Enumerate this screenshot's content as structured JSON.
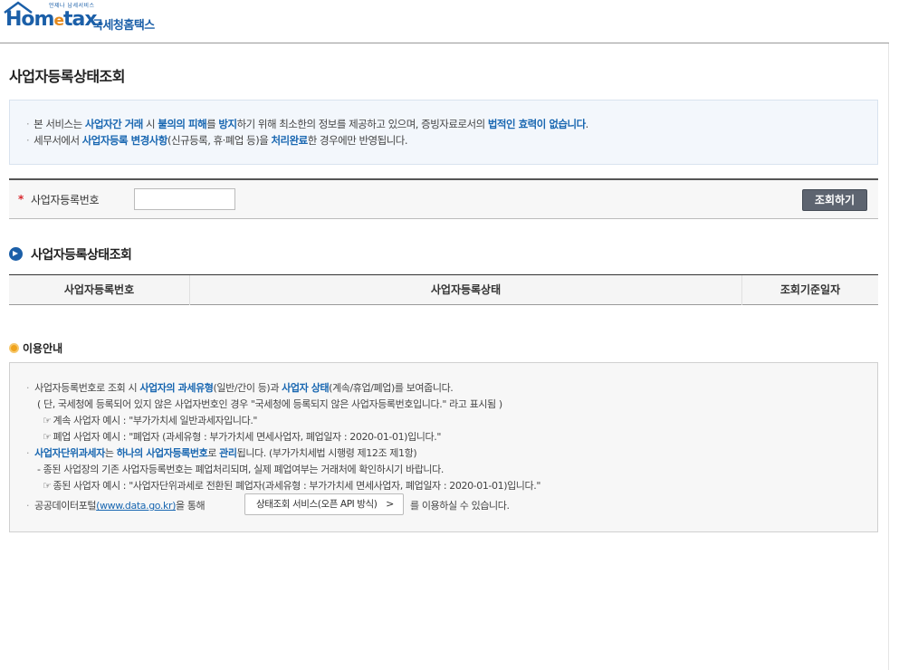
{
  "header": {
    "logo_tagline": "언제나 납세서비스",
    "logo_home": "Hom",
    "logo_e": "e",
    "logo_tax": "tax.",
    "logo_korean": "국세청홈택스"
  },
  "page_title": "사업자등록상태조회",
  "notice": {
    "line1": {
      "t1": "본 서비스는 ",
      "h1": "사업자간 거래",
      "t2": " 시 ",
      "h2": "불의의 피해",
      "t3": "를 ",
      "h3": "방지",
      "t4": "하기 위해 최소한의 정보를 제공하고 있으며, 증빙자료로서의 ",
      "h4": "법적인 효력이 없습니다",
      "t5": "."
    },
    "line2": {
      "t1": "세무서에서 ",
      "h1": "사업자등록 변경사항",
      "t2": "(신규등록, 휴·폐업 등)을 ",
      "h2": "처리완료",
      "t3": "한 경우에만 반영됩니다."
    }
  },
  "search": {
    "required_mark": "*",
    "label": "사업자등록번호",
    "input_value": "",
    "button": "조회하기"
  },
  "result_section": {
    "title": "사업자등록상태조회",
    "columns": [
      "사업자등록번호",
      "사업자등록상태",
      "조회기준일자"
    ]
  },
  "usage": {
    "title": "이용안내",
    "l1": {
      "t1": "사업자등록번호로 조회 시 ",
      "h1": "사업자의 과세유형",
      "t2": "(일반/간이 등)과 ",
      "h2": "사업자 상태",
      "t3": "(계속/휴업/폐업)를 보여줍니다."
    },
    "l2": "( 단, 국세청에 등록되어 있지 않은 사업자번호인 경우 \"국세청에 등록되지 않은 사업자등록번호입니다.\" 라고 표시됨 )",
    "l3": "계속 사업자 예시 : \"부가가치세 일반과세자입니다.\"",
    "l4": "폐업 사업자 예시 : \"폐업자 (과세유형 : 부가가치세 면세사업자, 폐업일자 : 2020-01-01)입니다.\"",
    "l5": {
      "h1": "사업자단위과세자",
      "t1": "는 ",
      "h2": "하나의 사업자등록번호",
      "t2": "로 ",
      "h3": "관리",
      "t3": "됩니다. (부가가치세법 시행령 제12조 제1항)"
    },
    "l6": "- 종된 사업장의 기존 사업자등록번호는 폐업처리되며, 실제 폐업여부는 거래처에 확인하시기 바랍니다.",
    "l7": "종된 사업자 예시 : \"사업자단위과세로 전환된 폐업자(과세유형 : 부가가치세 면세사업자, 폐업일자 : 2020-01-01)입니다.\"",
    "l8": {
      "t1": "공공데이터포털",
      "link": "(www.data.go.kr)",
      "t2": "을 통해",
      "t3": "를 이용하실 수 있습니다."
    },
    "api_button": "상태조회 서비스(오픈 API 방식)",
    "hand_glyph": "☞",
    "bullet": "·"
  },
  "colors": {
    "brand_blue": "#1b5fa8",
    "highlight": "#1967b1",
    "required": "#d8282e",
    "button_bg": "#5d6470"
  }
}
